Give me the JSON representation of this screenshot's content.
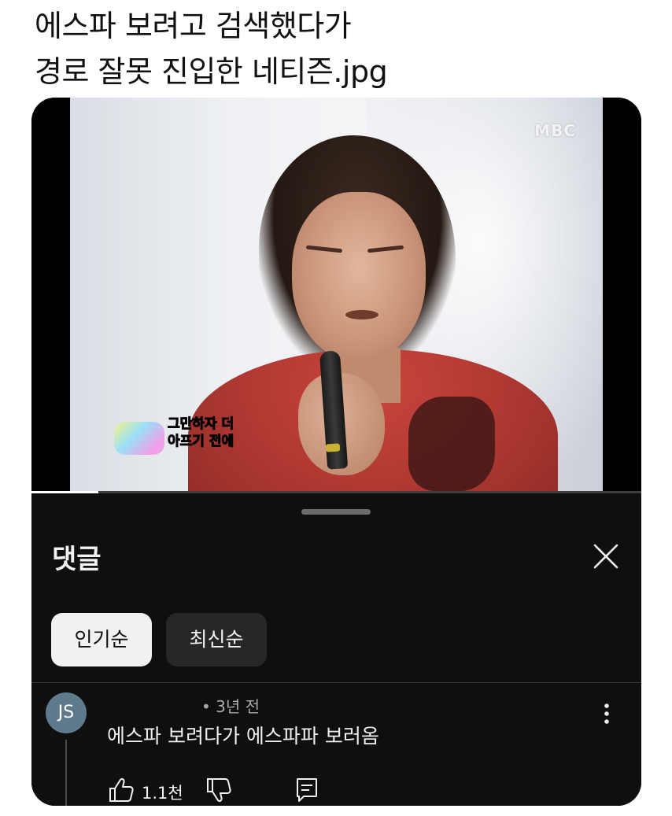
{
  "post": {
    "title_line1": "에스파 보려고 검색했다가",
    "title_line2": "경로 잘못 진입한 네티즌.jpg"
  },
  "video": {
    "channel_watermark": "MBC",
    "subtitle_line1": "그만하자 더",
    "subtitle_line2": "아프기 전에",
    "progress_fraction": 0.11
  },
  "comments_sheet": {
    "title": "댓글",
    "close_icon": "close-icon",
    "sort_chips": [
      {
        "label": "인기순",
        "selected": true
      },
      {
        "label": "최신순",
        "selected": false
      }
    ]
  },
  "comments": [
    {
      "avatar_initials": "JS",
      "meta": "• 3년 전",
      "text": "에스파 보려다가 에스파파 보러옴",
      "likes": "1.1천"
    }
  ],
  "colors": {
    "sheet_bg": "#0f0f0f",
    "chip_active_bg": "#f1f1f1",
    "chip_inactive_bg": "#272727",
    "avatar_bg": "#5f7a8c",
    "text_primary": "#f1f1f1",
    "text_secondary": "#aaaaaa"
  }
}
